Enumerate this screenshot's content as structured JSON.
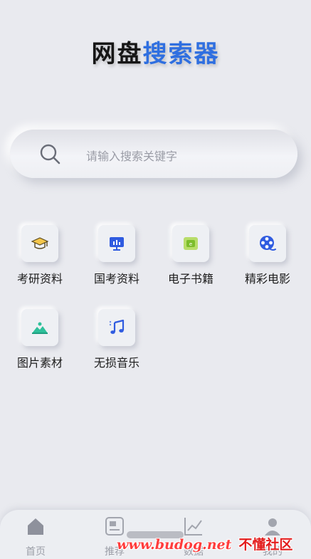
{
  "header": {
    "title_part1": "网盘",
    "title_part2": "搜索器"
  },
  "search": {
    "placeholder": "请输入搜索关键字"
  },
  "categories": [
    {
      "label": "考研资料",
      "icon": "graduation-cap-icon"
    },
    {
      "label": "国考资料",
      "icon": "presentation-board-icon"
    },
    {
      "label": "电子书籍",
      "icon": "ebook-icon"
    },
    {
      "label": "精彩电影",
      "icon": "film-reel-icon"
    },
    {
      "label": "图片素材",
      "icon": "landscape-image-icon"
    },
    {
      "label": "无损音乐",
      "icon": "music-note-icon"
    }
  ],
  "tabbar": {
    "tabs": [
      {
        "label": "首页",
        "icon": "home-icon"
      },
      {
        "label": "推荐",
        "icon": "recommend-icon"
      },
      {
        "label": "数据",
        "icon": "chart-trend-icon"
      },
      {
        "label": "我的",
        "icon": "user-icon"
      }
    ]
  },
  "watermark": {
    "url": "www.budog.net",
    "text": "不懂社区"
  },
  "colors": {
    "background": "#e9eaef",
    "title_dark": "#161616",
    "title_accent": "#2f6fe0",
    "icon_blue": "#2f5be0",
    "icon_green": "#2ec09a"
  }
}
